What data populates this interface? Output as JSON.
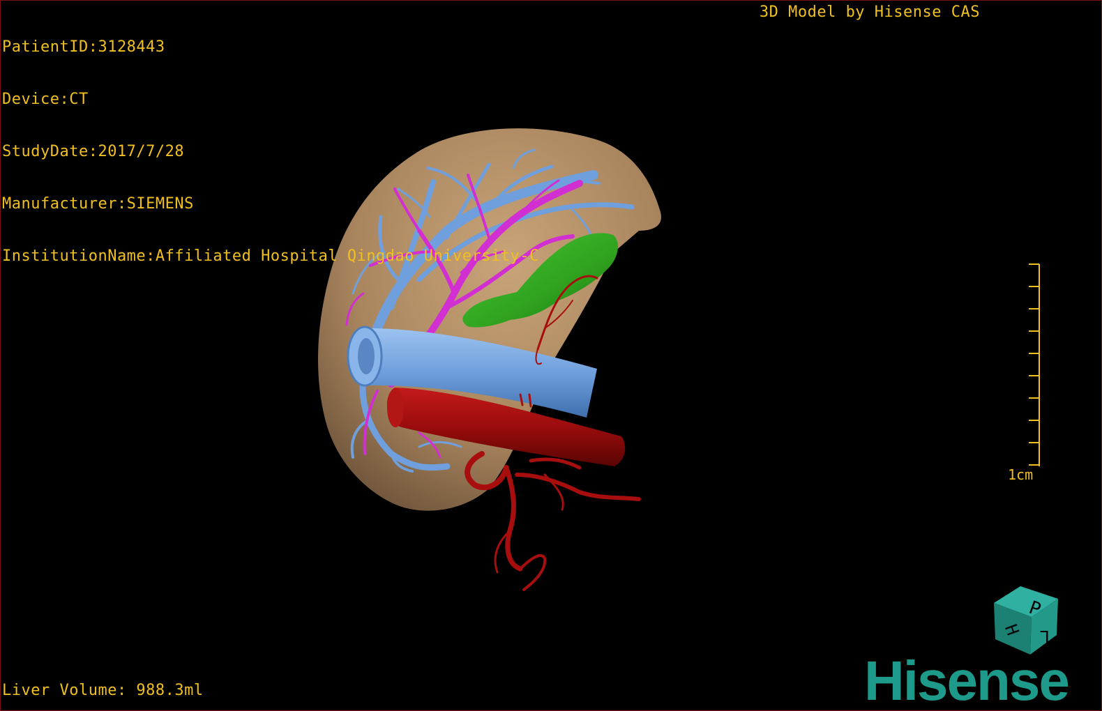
{
  "info": {
    "patient_id": "PatientID:3128443",
    "device": "Device:CT",
    "study_date": "StudyDate:2017/7/28",
    "manufacturer": "Manufacturer:SIEMENS",
    "institution": "InstitutionName:Affiliated Hospital Qingdao University-C"
  },
  "credit": "3D Model by Hisense CAS",
  "liver_volume": "Liver Volume: 988.3ml",
  "scale": {
    "label": "1cm"
  },
  "orientation_cube": {
    "face_top": "P",
    "face_left": "H",
    "face_right": "L"
  },
  "logo": {
    "text": "Hisense"
  },
  "colors": {
    "overlay_text": "#f0c020",
    "liver": "#b89268",
    "hepatic_vein": "#6f9fdc",
    "portal_vein": "#d22fd2",
    "artery": "#a80e0e",
    "gallbladder": "#2fa11e",
    "brand": "#1d9a8a"
  },
  "icons": [
    "orientation-cube-icon",
    "scale-bar-icon",
    "hisense-logo"
  ]
}
